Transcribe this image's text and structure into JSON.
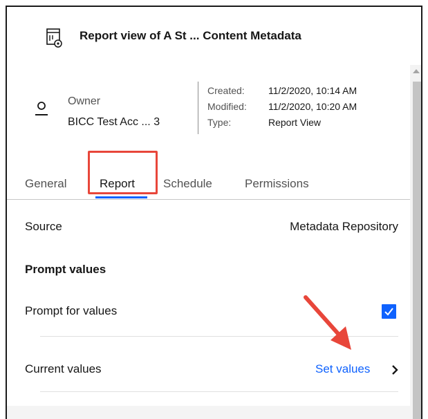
{
  "panel": {
    "title": "Report view of A St ... Content Metadata",
    "title_icon": "report-view-icon"
  },
  "owner": {
    "icon": "user-icon",
    "label": "Owner",
    "name": "BICC Test Acc ... 3"
  },
  "meta": [
    {
      "key": "Created:",
      "value": "11/2/2020, 10:14 AM"
    },
    {
      "key": "Modified:",
      "value": "11/2/2020, 10:20 AM"
    },
    {
      "key": "Type:",
      "value": "Report View"
    }
  ],
  "tabs": [
    {
      "label": "General",
      "active": false
    },
    {
      "label": "Report",
      "active": true
    },
    {
      "label": "Schedule",
      "active": false
    },
    {
      "label": "Permissions",
      "active": false
    }
  ],
  "report": {
    "source_label": "Source",
    "source_value": "Metadata Repository",
    "prompt_section_title": "Prompt values",
    "prompt_for_values_label": "Prompt for values",
    "prompt_for_values_checked": true,
    "current_values_label": "Current values",
    "set_values_link": "Set values"
  },
  "colors": {
    "accent": "#0f62fe",
    "annotation": "#e8463a"
  }
}
